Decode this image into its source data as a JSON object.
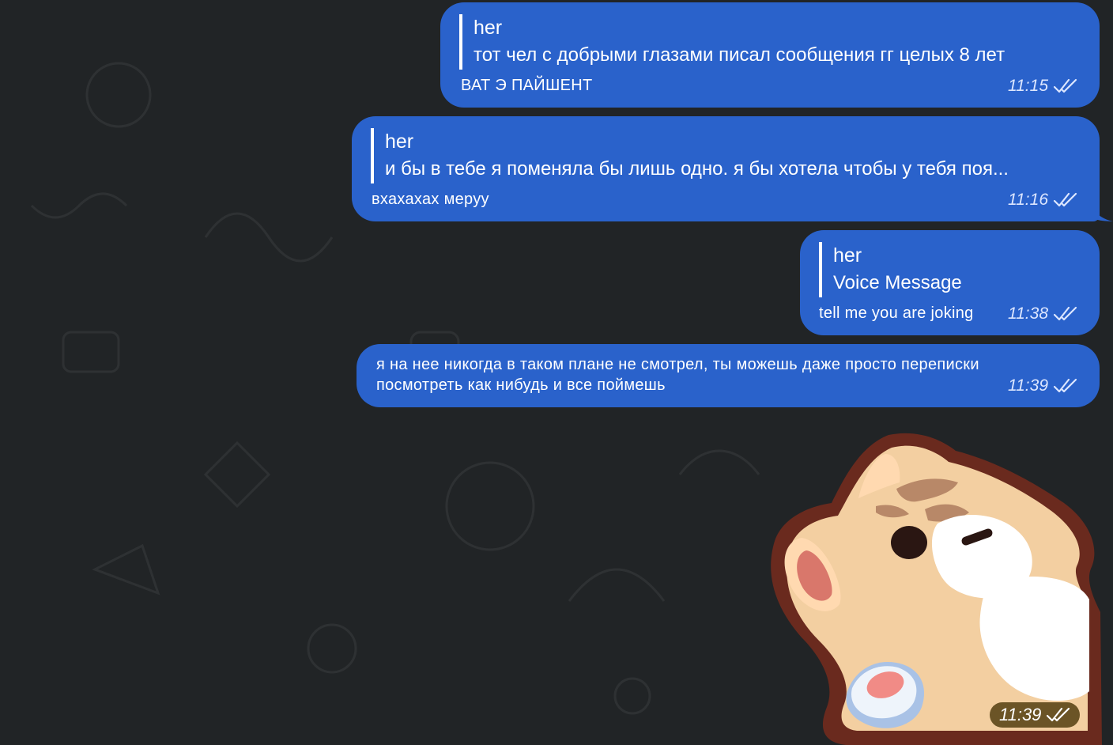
{
  "messages": [
    {
      "reply_author": "her",
      "reply_quote": "тот чел с добрыми глазами писал сообщения гг целых 8 лет",
      "text": "ВАТ Э ПАЙШЕНТ",
      "time": "11:15"
    },
    {
      "reply_author": "her",
      "reply_quote": "и бы в тебе я поменяла бы лишь одно. я бы хотела чтобы у тебя поя...",
      "text": "вхахахах меруу",
      "time": "11:16"
    },
    {
      "reply_author": "her",
      "reply_quote": "Voice Message",
      "text": "tell me you are joking",
      "time": "11:38"
    },
    {
      "text_line1": "я на нее никогда в таком плане не смотрел, ты можешь даже просто переписки",
      "text_line2": "посмотреть как нибудь и все поймешь",
      "time": "11:39"
    }
  ],
  "sticker": {
    "icon": "cat-sticker",
    "time": "11:39"
  },
  "colors": {
    "background": "#212426",
    "bubble": "#2a62cb",
    "sticker_time_badge": "#6b5426"
  }
}
